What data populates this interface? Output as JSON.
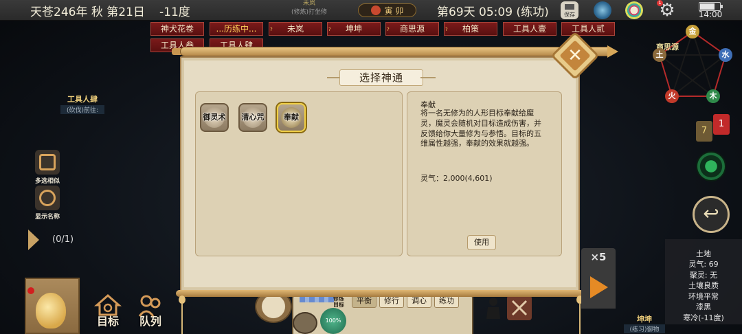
{
  "statusbar": {
    "date": "天苍246年 秋 第21日",
    "temperature": "-11度",
    "npc_name": "未岚",
    "npc_status": "(修炼)打坐修",
    "clock_label": "寅 卯",
    "day_time": "第69天 05:09 (练功)",
    "save_label": "保存",
    "alert_count": "1",
    "battery_level": 0.75,
    "phone_time": "14:00"
  },
  "tabs": [
    {
      "label": "神犬花卷",
      "marker": ""
    },
    {
      "label": "...历练中...",
      "marker": ""
    },
    {
      "label": "未岚",
      "marker": "?"
    },
    {
      "label": "坤坤",
      "marker": "?"
    },
    {
      "label": "商思源",
      "marker": "?"
    },
    {
      "label": "柏策",
      "marker": "?"
    },
    {
      "label": "工具人壹",
      "marker": ""
    },
    {
      "label": "工具人贰",
      "marker": ""
    },
    {
      "label": "工具人叁",
      "marker": ""
    },
    {
      "label": "工具人肆",
      "marker": ""
    }
  ],
  "left_panel": {
    "npc_name": "工具人肆",
    "npc_status": "(砍伐)前往:",
    "multi_select_label": "多选相似",
    "show_names_label": "显示名称",
    "page_count": "(0/1)"
  },
  "bottom": {
    "target_label": "目标",
    "queue_label": "队列",
    "cultivate_label": "修炼目标",
    "modes": [
      "平衡",
      "修行",
      "调心",
      "练功"
    ],
    "active_mode": "平衡",
    "progress_label": "100%",
    "progress": 1.0
  },
  "dialog": {
    "title": "选择神通",
    "skills": [
      {
        "name": "御灵术",
        "selected": false
      },
      {
        "name": "清心咒",
        "selected": false
      },
      {
        "name": "奉献",
        "selected": true
      }
    ],
    "detail": {
      "name": "奉献",
      "description": "将一名无修为的人形目标奉献给魔灵，魔灵会随机对目标造成伤害，并反馈给你大量修为与参悟。目标的五维属性越强，奉献的效果就越强。",
      "cost": "灵气：2,000(4,601)",
      "use_label": "使用"
    }
  },
  "right_panel": {
    "wuxing_label": "商思源",
    "wuxing": [
      "金",
      "木",
      "水",
      "火",
      "土"
    ],
    "msg_count_yellow": "7",
    "msg_count_red": "1",
    "speed_label": "×5",
    "stats": {
      "title": "土地",
      "lines": [
        "灵气: 69",
        "聚灵: 无",
        "土壤良质",
        "环境平常",
        "漆黑",
        "寒冷(-11度)"
      ]
    },
    "npc_name": "坤坤",
    "npc_status": "(练习)御物"
  },
  "colors": {
    "tab_bg": "#6a1414",
    "parchment": "#e6dcc4",
    "selected_border": "#f0cf45",
    "accent_orange": "#e58a25"
  }
}
